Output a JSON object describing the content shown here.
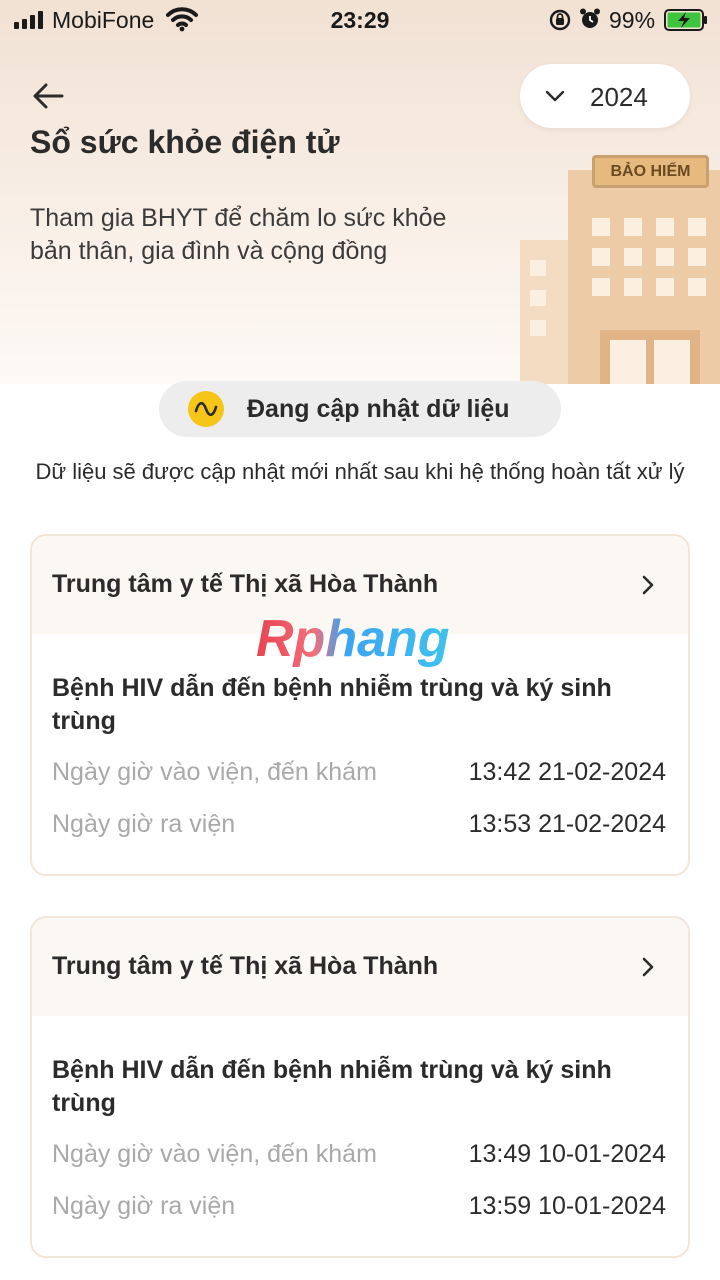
{
  "status_bar": {
    "carrier": "MobiFone",
    "time": "23:29",
    "battery": "99%",
    "icons": [
      "signal-icon",
      "wifi-icon",
      "rotation-lock-icon",
      "alarm-icon",
      "battery-charging-icon"
    ]
  },
  "header": {
    "back_icon": "arrow-left-icon",
    "year_selector": {
      "value": "2024",
      "icon": "chevron-down-icon"
    },
    "title": "Sổ sức khỏe điện tử",
    "description": "Tham gia BHYT để chăm lo sức khỏe bản thân, gia đình và cộng đồng",
    "illustration_sign": "BẢO HIỂM"
  },
  "update_status": {
    "label": "Đang cập nhật dữ liệu",
    "note": "Dữ liệu sẽ được cập nhật mới nhất sau khi hệ thống hoàn tất xử lý",
    "icon_color": "#f5c518"
  },
  "watermark": "Rphang",
  "records": [
    {
      "facility": "Trung tâm y tế Thị xã Hòa Thành",
      "diagnosis": "Bệnh HIV dẫn đến bệnh nhiễm trùng và ký sinh trùng",
      "admission_label": "Ngày giờ vào viện, đến khám",
      "admission_value": "13:42 21-02-2024",
      "discharge_label": "Ngày giờ ra viện",
      "discharge_value": "13:53 21-02-2024"
    },
    {
      "facility": "Trung tâm y tế Thị xã Hòa Thành",
      "diagnosis": "Bệnh HIV dẫn đến bệnh nhiễm trùng và ký sinh trùng",
      "admission_label": "Ngày giờ vào viện, đến khám",
      "admission_value": "13:49 10-01-2024",
      "discharge_label": "Ngày giờ ra viện",
      "discharge_value": "13:59 10-01-2024"
    }
  ],
  "colors": {
    "header_bg": "#f4e6da",
    "card_border": "#f1e6da",
    "muted_text": "#a9a9a9",
    "pill_bg": "#ededed"
  }
}
